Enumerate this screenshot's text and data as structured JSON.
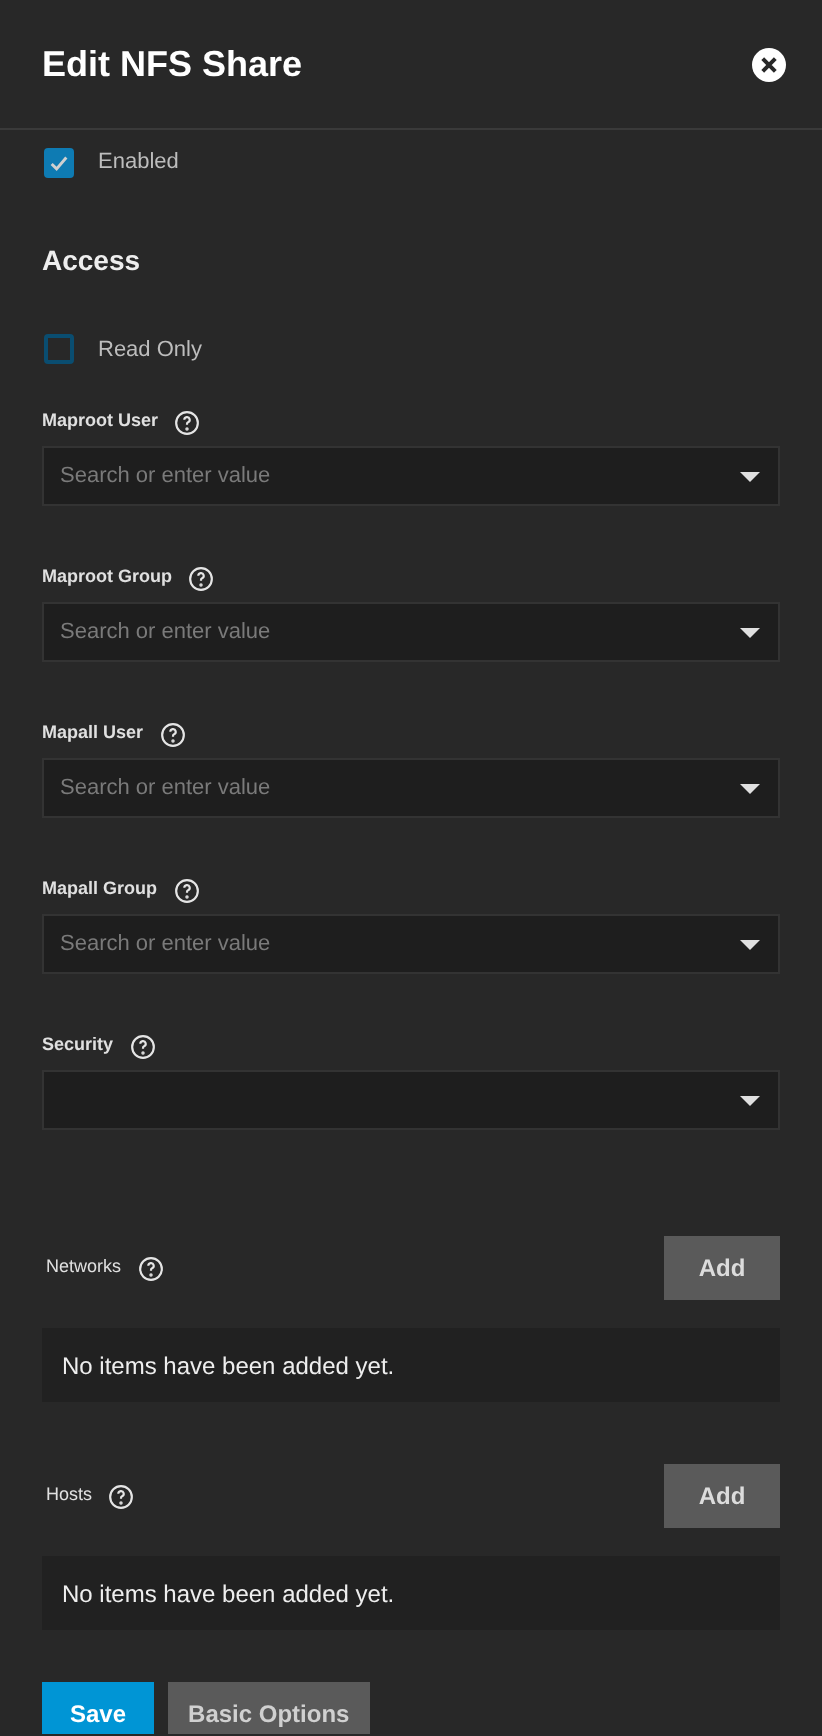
{
  "header": {
    "title": "Edit NFS Share"
  },
  "enabled": {
    "label": "Enabled",
    "checked": true
  },
  "access": {
    "heading": "Access",
    "read_only": {
      "label": "Read Only",
      "checked": false
    },
    "fields": [
      {
        "label": "Maproot User",
        "placeholder": "Search or enter value"
      },
      {
        "label": "Maproot Group",
        "placeholder": "Search or enter value"
      },
      {
        "label": "Mapall User",
        "placeholder": "Search or enter value"
      },
      {
        "label": "Mapall Group",
        "placeholder": "Search or enter value"
      },
      {
        "label": "Security"
      }
    ]
  },
  "lists": [
    {
      "label": "Networks",
      "button": "Add",
      "empty": "No items have been added yet."
    },
    {
      "label": "Hosts",
      "button": "Add",
      "empty": "No items have been added yet."
    }
  ],
  "actions": [
    {
      "label": "Save",
      "kind": "primary"
    },
    {
      "label": "Basic Options",
      "kind": "secondary"
    }
  ]
}
